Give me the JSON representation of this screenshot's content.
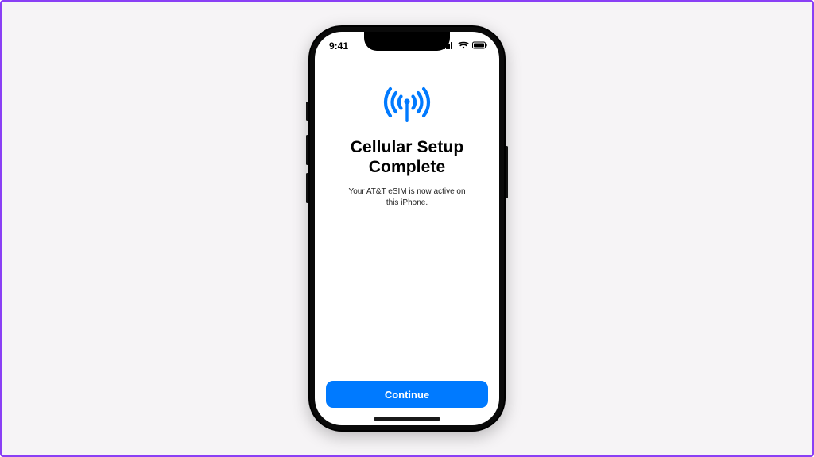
{
  "status": {
    "time": "9:41"
  },
  "screen": {
    "title": "Cellular Setup\nComplete",
    "subtitle": "Your AT&T eSIM is now active on\nthis iPhone."
  },
  "cta": {
    "label": "Continue"
  },
  "colors": {
    "accent": "#007aff"
  }
}
